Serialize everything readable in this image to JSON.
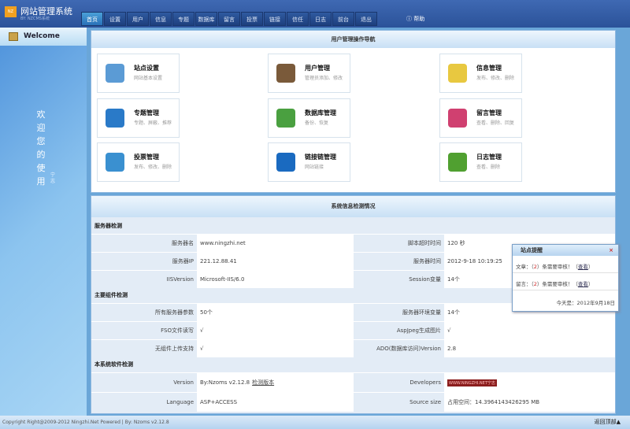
{
  "header": {
    "title": "网站管理系统",
    "subtitle": "BY: NZCMS系统",
    "logo_text": "NZ",
    "tabs": [
      "首页",
      "设置",
      "用户",
      "信息",
      "专题",
      "数据库",
      "留言",
      "投票",
      "链接",
      "信任",
      "日志",
      "前台",
      "退出"
    ],
    "active_tab": 0,
    "help": "帮助"
  },
  "sidebar": {
    "welcome": "Welcome",
    "vertical_text": "欢迎您的使用",
    "small_text": "宁志"
  },
  "nav": {
    "title": "用户管理操作导航",
    "cards": [
      {
        "title": "站点设置",
        "desc": "网站基本设置",
        "icon": "house-icon",
        "color": "#5b9bd5"
      },
      {
        "title": "用户管理",
        "desc": "管理员添加、修改",
        "icon": "user-icon",
        "color": "#7a5a3a"
      },
      {
        "title": "信息管理",
        "desc": "发布、修改、删除",
        "icon": "note-icon",
        "color": "#e8c840"
      },
      {
        "title": "专题管理",
        "desc": "专题、屏蔽、推荐",
        "icon": "book-icon",
        "color": "#2a7ac8"
      },
      {
        "title": "数据库管理",
        "desc": "备份、恢复",
        "icon": "database-icon",
        "color": "#4aa040"
      },
      {
        "title": "留言管理",
        "desc": "查看、删除、回复",
        "icon": "message-book-icon",
        "color": "#d04070"
      },
      {
        "title": "投票管理",
        "desc": "发布、修改、删除",
        "icon": "bar-chart-icon",
        "color": "#3a90d0"
      },
      {
        "title": "链接链管理",
        "desc": "网站链接",
        "icon": "ie-icon",
        "color": "#1a6ac0"
      },
      {
        "title": "日志管理",
        "desc": "查看、删除",
        "icon": "checked-doc-icon",
        "color": "#50a030"
      }
    ]
  },
  "system": {
    "title": "系统信息检测情况",
    "sections": [
      {
        "title": "服务器检测",
        "rows": [
          [
            "服务器名",
            "www.ningzhi.net",
            "脚本超时时间",
            "120 秒"
          ],
          [
            "服务器IP",
            "221.12.88.41",
            "服务器时间",
            "2012-9-18 10:19:25"
          ],
          [
            "IISVersion",
            "Microsoft-IIS/6.0",
            "Session变量",
            "14个"
          ]
        ]
      },
      {
        "title": "主要组件检测",
        "rows": [
          [
            "所有服务器参数",
            "50个",
            "服务器环境变量",
            "14个"
          ],
          [
            "FSO文件读写",
            "√",
            "AspJpeg生成图片",
            "√"
          ],
          [
            "无组件上传支持",
            "√",
            "ADO(数据库访问)Version",
            "2.8"
          ]
        ]
      },
      {
        "title": "本系统软件检测",
        "rows": [
          [
            "Version",
            "By:Nzoms v2.12.8",
            "Developers",
            "WWW.NINGZHI.NET宁志"
          ],
          [
            "Language",
            "ASP+ACCESS",
            "Source size",
            "占用空间：14.3964143426295 MB"
          ]
        ]
      }
    ],
    "version_link": "检测版本"
  },
  "popup": {
    "title": "站点提醒",
    "close": "×",
    "lines": [
      {
        "prefix": "文章：（",
        "count": "2",
        "suffix": "）条需要审核！（",
        "link": "查看",
        "end": "）"
      },
      {
        "prefix": "留言：（",
        "count": "2",
        "suffix": "）条需要审核！（",
        "link": "查看",
        "end": "）"
      }
    ],
    "date": "今天是：2012年9月18日"
  },
  "footer": {
    "copyright": "Copyright Right@2009-2012 Ningzhi.Net Powered | By: Nzoms v2.12.8",
    "back_top": "返回顶部▲"
  }
}
